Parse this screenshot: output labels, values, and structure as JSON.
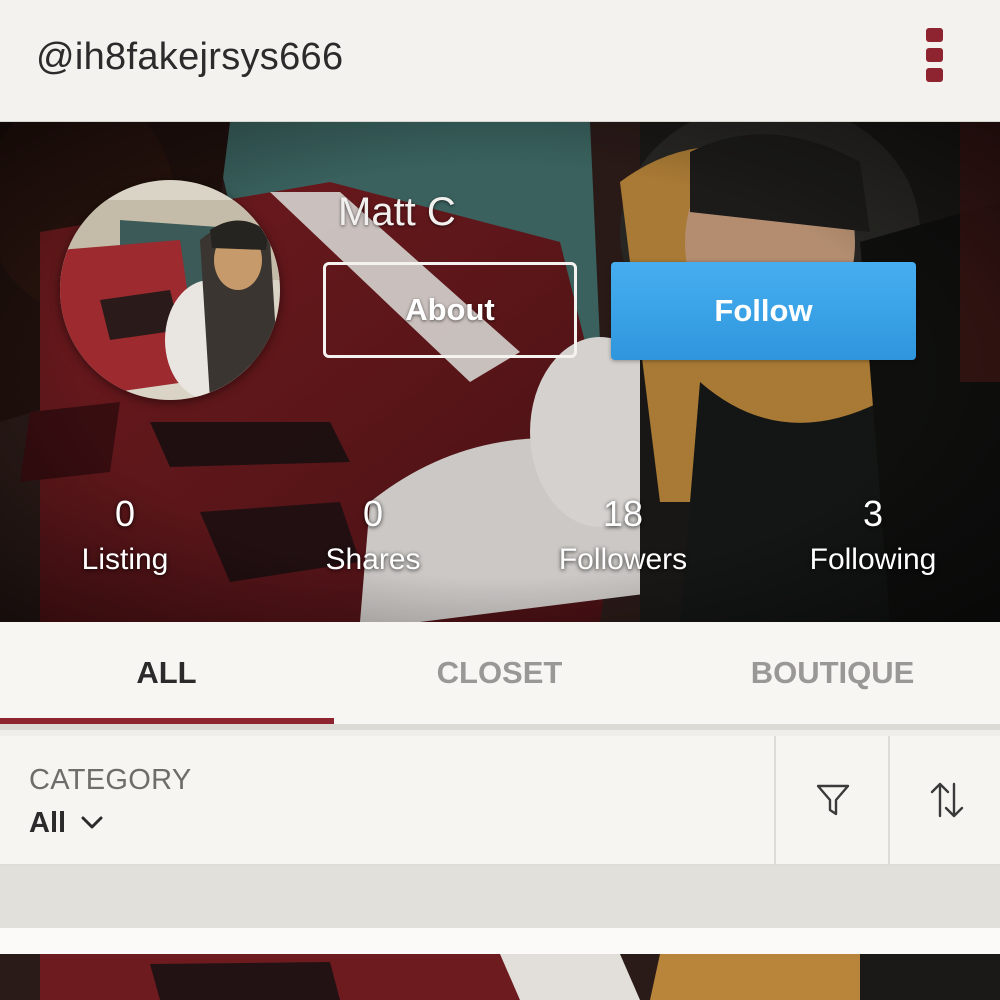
{
  "header": {
    "username": "@ih8fakejrsys666",
    "menu_icon": "more-vert-icon",
    "accent_color": "#8e2430"
  },
  "profile": {
    "name": "Matt C",
    "about_label": "About",
    "follow_label": "Follow",
    "follow_color": "#3aa3e8"
  },
  "stats": [
    {
      "value": "0",
      "label": "Listing"
    },
    {
      "value": "0",
      "label": "Shares"
    },
    {
      "value": "18",
      "label": "Followers"
    },
    {
      "value": "3",
      "label": "Following"
    }
  ],
  "tabs": {
    "items": [
      {
        "label": "ALL",
        "active": true
      },
      {
        "label": "CLOSET",
        "active": false
      },
      {
        "label": "BOUTIQUE",
        "active": false
      }
    ]
  },
  "filters": {
    "category_label": "CATEGORY",
    "category_value": "All",
    "chevron_icon": "chevron-down-icon",
    "filter_icon": "funnel-icon",
    "sort_icon": "sort-arrows-icon"
  }
}
